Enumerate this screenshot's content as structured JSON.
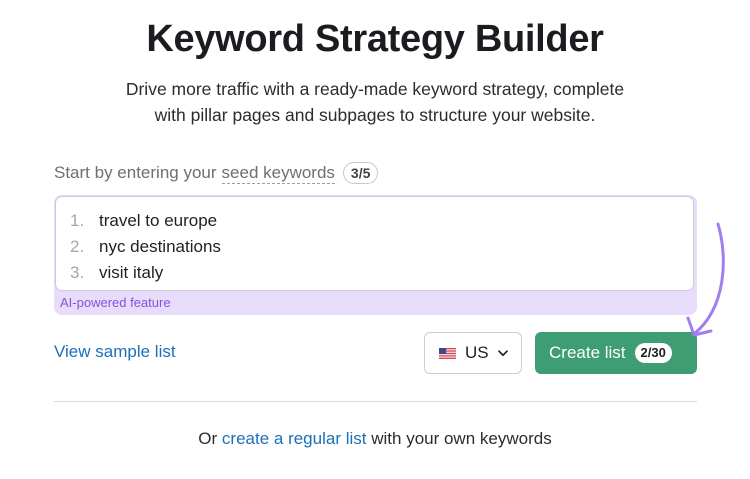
{
  "header": {
    "title": "Keyword Strategy Builder",
    "subtitle_line1": "Drive more traffic with a ready-made keyword strategy, complete",
    "subtitle_line2": "with pillar pages and subpages to structure your website."
  },
  "seed": {
    "prompt_prefix": "Start by entering your",
    "prompt_term": "seed keywords",
    "count": "3/5"
  },
  "keywords": {
    "items": [
      {
        "num": "1.",
        "text": "travel to europe"
      },
      {
        "num": "2.",
        "text": "nyc destinations"
      },
      {
        "num": "3.",
        "text": "visit italy"
      }
    ],
    "ai_label": "AI-powered feature"
  },
  "actions": {
    "sample_link": "View sample list",
    "country": "US",
    "country_icon": "us-flag-icon",
    "create_label": "Create list",
    "create_count": "2/30"
  },
  "footer": {
    "prefix": "Or",
    "link": "create a regular list",
    "suffix": "with your own keywords"
  },
  "colors": {
    "accent_green": "#3f9d74",
    "link_blue": "#1c6fb8",
    "ai_purple": "#8a4fe0",
    "arrow_purple": "#a07ef0"
  }
}
